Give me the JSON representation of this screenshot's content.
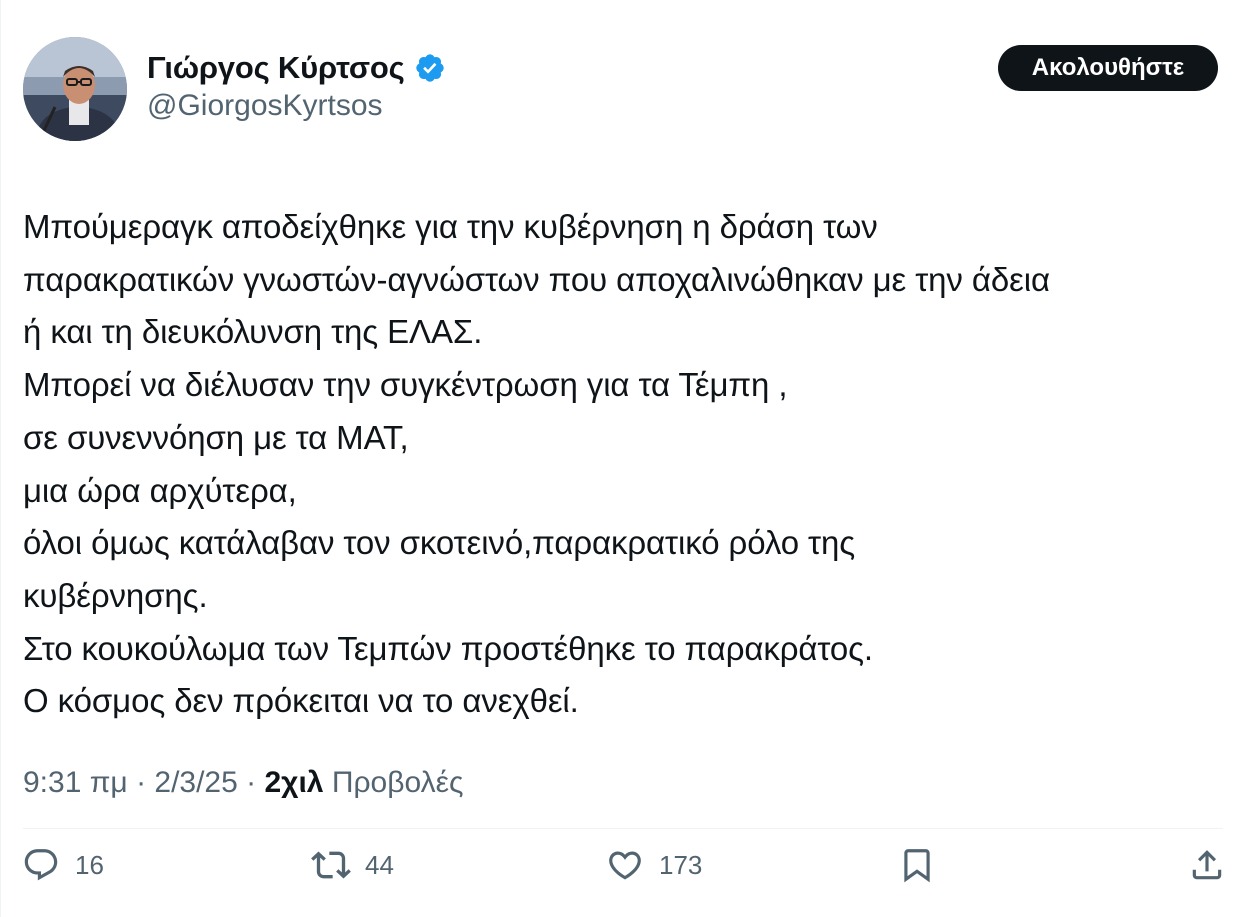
{
  "author": {
    "display_name": "Γιώργος Κύρτσος",
    "handle": "@GiorgosKyrtsos",
    "verified": true,
    "verified_color": "#1d9bf0"
  },
  "follow_button": {
    "label": "Ακολουθήστε"
  },
  "tweet": {
    "lines": [
      "Μπούμεραγκ αποδείχθηκε για την κυβέρνηση η δράση των",
      "παρακρατικών γνωστών-αγνώστων που αποχαλινώθηκαν με την άδεια",
      "ή και τη διευκόλυνση της ΕΛΑΣ.",
      "Μπορεί να διέλυσαν την συγκέντρωση για τα Τέμπη ,",
      "σε συνεννόηση με τα ΜΑΤ,",
      "μια ώρα αρχύτερα,",
      "όλοι όμως κατάλαβαν τον σκοτεινό,παρακρατικό ρόλο της",
      "κυβέρνησης.",
      "Στο κουκούλωμα των Τεμπών προστέθηκε το παρακράτος.",
      "Ο κόσμος δεν πρόκειται να το ανεχθεί."
    ]
  },
  "meta": {
    "time": "9:31 πμ",
    "separator": "·",
    "date": "2/3/25",
    "views_count": "2χιλ",
    "views_label": "Προβολές"
  },
  "actions": {
    "replies": {
      "icon": "reply-icon",
      "count": "16"
    },
    "reposts": {
      "icon": "repost-icon",
      "count": "44"
    },
    "likes": {
      "icon": "heart-icon",
      "count": "173"
    },
    "bookmark": {
      "icon": "bookmark-icon"
    },
    "share": {
      "icon": "share-icon"
    }
  },
  "colors": {
    "text": "#0f1419",
    "secondary": "#536471",
    "button_bg": "#0f1419",
    "button_text": "#ffffff"
  }
}
